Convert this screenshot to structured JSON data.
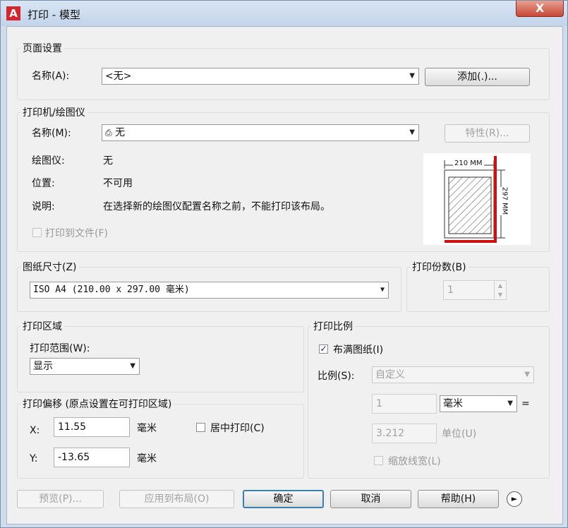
{
  "window": {
    "title": "打印 - 模型",
    "close_symbol": "X"
  },
  "icons": {
    "app": "autocad-logo-icon",
    "expand": "arrow-right-circle-icon",
    "dropdown": "chevron-down-icon"
  },
  "page_setup": {
    "group": "页面设置",
    "name_label": "名称(A):",
    "name_value": "<无>",
    "add_button": "添加(.)..."
  },
  "printer": {
    "group": "打印机/绘图仪",
    "name_label": "名称(M):",
    "name_value": "无",
    "properties_button": "特性(R)...",
    "plotter_label": "绘图仪:",
    "plotter_value": "无",
    "location_label": "位置:",
    "location_value": "不可用",
    "description_label": "说明:",
    "description_value": "在选择新的绘图仪配置名称之前，不能打印该布局。",
    "print_to_file_label": "打印到文件(F)",
    "print_to_file_checked": false,
    "preview": {
      "width_label": "210 MM",
      "height_label": "297 MM"
    }
  },
  "paper_size": {
    "group": "图纸尺寸(Z)",
    "value": "ISO A4 (210.00 x 297.00 毫米)"
  },
  "copies": {
    "group": "打印份数(B)",
    "value": "1"
  },
  "plot_area": {
    "group": "打印区域",
    "range_label": "打印范围(W):",
    "range_value": "显示"
  },
  "plot_offset": {
    "group": "打印偏移 (原点设置在可打印区域)",
    "x_label": "X:",
    "x_value": "11.55",
    "x_unit": "毫米",
    "y_label": "Y:",
    "y_value": "-13.65",
    "y_unit": "毫米",
    "center_label": "居中打印(C)",
    "center_checked": false
  },
  "plot_scale": {
    "group": "打印比例",
    "fit_label": "布满图纸(I)",
    "fit_checked": true,
    "scale_label": "比例(S):",
    "scale_value": "自定义",
    "value1": "1",
    "unit_value": "毫米",
    "equals": "=",
    "value2": "3.212",
    "unit2_label": "单位(U)",
    "lineweight_label": "缩放线宽(L)",
    "lineweight_checked": false
  },
  "buttons": {
    "preview": "预览(P)...",
    "apply": "应用到布局(O)",
    "ok": "确定",
    "cancel": "取消",
    "help": "帮助(H)"
  },
  "colors": {
    "accent_blue": "#3c7fb1",
    "title_bg": "#c9d9ee",
    "close_red": "#c74837",
    "preview_red": "#d01010"
  }
}
